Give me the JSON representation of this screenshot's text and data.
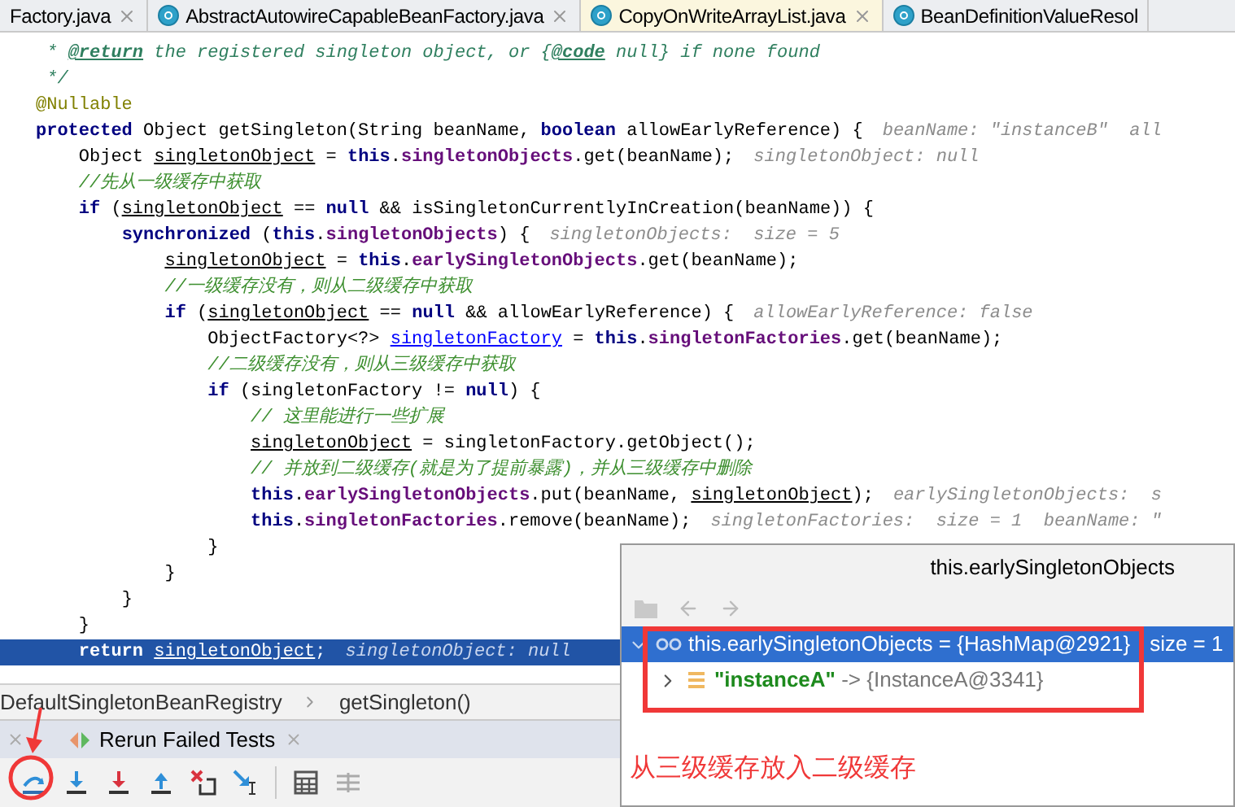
{
  "tabs": [
    {
      "label": "Factory.java",
      "selected": false,
      "icon": false
    },
    {
      "label": "AbstractAutowireCapableBeanFactory.java",
      "selected": false,
      "icon": true
    },
    {
      "label": "CopyOnWriteArrayList.java",
      "selected": true,
      "icon": true
    },
    {
      "label": "BeanDefinitionValueResol",
      "selected": false,
      "icon": true
    }
  ],
  "code_lines": [
    {
      "current": false,
      "tokens": [
        {
          "kind": "doc",
          "text": " * "
        },
        {
          "kind": "doctag",
          "text": "@return"
        },
        {
          "kind": "doc",
          "text": " the registered singleton object, or {"
        },
        {
          "kind": "doctag",
          "text": "@code"
        },
        {
          "kind": "doc",
          "text": " null} if none found"
        }
      ]
    },
    {
      "current": false,
      "tokens": [
        {
          "kind": "doc",
          "text": " */"
        }
      ]
    },
    {
      "current": false,
      "tokens": [
        {
          "kind": "annotation",
          "text": "@Nullable"
        }
      ]
    },
    {
      "current": false,
      "tokens": [
        {
          "kind": "keyword",
          "text": "protected"
        },
        {
          "kind": "plain",
          "text": " Object getSingleton(String beanName, "
        },
        {
          "kind": "keyword",
          "text": "boolean"
        },
        {
          "kind": "plain",
          "text": " allowEarlyReference) {"
        }
      ],
      "hint": "beanName: \"instanceB\"  all"
    },
    {
      "current": false,
      "tokens": [
        {
          "kind": "plain",
          "text": "    Object "
        },
        {
          "kind": "var",
          "text": "singletonObject"
        },
        {
          "kind": "plain",
          "text": " = "
        },
        {
          "kind": "keyword",
          "text": "this"
        },
        {
          "kind": "plain",
          "text": "."
        },
        {
          "kind": "field",
          "text": "singletonObjects"
        },
        {
          "kind": "plain",
          "text": ".get(beanName);"
        }
      ],
      "hint": "singletonObject: null"
    },
    {
      "current": false,
      "tokens": [
        {
          "kind": "comment",
          "text": "    //先从一级缓存中获取"
        }
      ]
    },
    {
      "current": false,
      "tokens": [
        {
          "kind": "keyword",
          "text": "    if"
        },
        {
          "kind": "plain",
          "text": " ("
        },
        {
          "kind": "var",
          "text": "singletonObject"
        },
        {
          "kind": "plain",
          "text": " == "
        },
        {
          "kind": "keyword",
          "text": "null"
        },
        {
          "kind": "plain",
          "text": " && isSingletonCurrentlyInCreation(beanName)) {"
        }
      ]
    },
    {
      "current": false,
      "tokens": [
        {
          "kind": "keyword",
          "text": "        synchronized"
        },
        {
          "kind": "plain",
          "text": " ("
        },
        {
          "kind": "keyword",
          "text": "this"
        },
        {
          "kind": "plain",
          "text": "."
        },
        {
          "kind": "field",
          "text": "singletonObjects"
        },
        {
          "kind": "plain",
          "text": ") {"
        }
      ],
      "hint": "singletonObjects:  size = 5"
    },
    {
      "current": false,
      "tokens": [
        {
          "kind": "var",
          "text": "            singletonObject"
        },
        {
          "kind": "plain",
          "text": " = "
        },
        {
          "kind": "keyword",
          "text": "this"
        },
        {
          "kind": "plain",
          "text": "."
        },
        {
          "kind": "field",
          "text": "earlySingletonObjects"
        },
        {
          "kind": "plain",
          "text": ".get(beanName);"
        }
      ]
    },
    {
      "current": false,
      "tokens": [
        {
          "kind": "comment",
          "text": "            //一级缓存没有，则从二级缓存中获取"
        }
      ]
    },
    {
      "current": false,
      "tokens": [
        {
          "kind": "keyword",
          "text": "            if"
        },
        {
          "kind": "plain",
          "text": " ("
        },
        {
          "kind": "var",
          "text": "singletonObject"
        },
        {
          "kind": "plain",
          "text": " == "
        },
        {
          "kind": "keyword",
          "text": "null"
        },
        {
          "kind": "plain",
          "text": " && allowEarlyReference) {"
        }
      ],
      "hint": "allowEarlyReference: false"
    },
    {
      "current": false,
      "tokens": [
        {
          "kind": "plain",
          "text": "                ObjectFactory<?> "
        },
        {
          "kind": "usage",
          "text": "singletonFactory"
        },
        {
          "kind": "plain",
          "text": " = "
        },
        {
          "kind": "keyword",
          "text": "this"
        },
        {
          "kind": "plain",
          "text": "."
        },
        {
          "kind": "field",
          "text": "singletonFactories"
        },
        {
          "kind": "plain",
          "text": ".get(beanName);"
        }
      ]
    },
    {
      "current": false,
      "tokens": [
        {
          "kind": "comment",
          "text": "                //二级缓存没有，则从三级缓存中获取"
        }
      ]
    },
    {
      "current": false,
      "tokens": [
        {
          "kind": "keyword",
          "text": "                if"
        },
        {
          "kind": "plain",
          "text": " (singletonFactory != "
        },
        {
          "kind": "keyword",
          "text": "null"
        },
        {
          "kind": "plain",
          "text": ") {"
        }
      ]
    },
    {
      "current": false,
      "tokens": [
        {
          "kind": "comment",
          "text": "                    // 这里能进行一些扩展"
        }
      ]
    },
    {
      "current": false,
      "tokens": [
        {
          "kind": "var",
          "text": "                    singletonObject"
        },
        {
          "kind": "plain",
          "text": " = singletonFactory.getObject();"
        }
      ]
    },
    {
      "current": false,
      "tokens": [
        {
          "kind": "comment",
          "text": "                    // 并放到二级缓存(就是为了提前暴露)，并从三级缓存中删除"
        }
      ]
    },
    {
      "current": false,
      "tokens": [
        {
          "kind": "keyword",
          "text": "                    this"
        },
        {
          "kind": "plain",
          "text": "."
        },
        {
          "kind": "field",
          "text": "earlySingletonObjects"
        },
        {
          "kind": "plain",
          "text": ".put(beanName, "
        },
        {
          "kind": "var",
          "text": "singletonObject"
        },
        {
          "kind": "plain",
          "text": ");"
        }
      ],
      "hint": "earlySingletonObjects:  s"
    },
    {
      "current": false,
      "tokens": [
        {
          "kind": "keyword",
          "text": "                    this"
        },
        {
          "kind": "plain",
          "text": "."
        },
        {
          "kind": "field",
          "text": "singletonFactories"
        },
        {
          "kind": "plain",
          "text": ".remove(beanName);"
        }
      ],
      "hint": "singletonFactories:  size = 1  beanName: \""
    },
    {
      "current": false,
      "tokens": [
        {
          "kind": "plain",
          "text": "                }"
        }
      ]
    },
    {
      "current": false,
      "tokens": [
        {
          "kind": "plain",
          "text": "            }"
        }
      ]
    },
    {
      "current": false,
      "tokens": [
        {
          "kind": "plain",
          "text": "        }"
        }
      ]
    },
    {
      "current": false,
      "tokens": [
        {
          "kind": "plain",
          "text": "    }"
        }
      ]
    },
    {
      "current": true,
      "tokens": [
        {
          "kind": "keyword",
          "text": "    return "
        },
        {
          "kind": "var",
          "text": "singletonObject"
        },
        {
          "kind": "plain",
          "text": ";"
        }
      ],
      "hint": "singletonObject: null"
    }
  ],
  "breadcrumb": [
    "DefaultSingletonBeanRegistry",
    "getSingleton()"
  ],
  "tool_tab": {
    "label": "Rerun Failed Tests"
  },
  "popup": {
    "title": "this.earlySingletonObjects",
    "tree": [
      {
        "text": "this.earlySingletonObjects = {HashMap@2921}",
        "detail": "size = 1",
        "selected": true,
        "expanded": true,
        "children": [
          {
            "key": "\"instanceA\"",
            "arrow": "->",
            "value": "{InstanceA@3341}",
            "selected": false,
            "expanded": false
          }
        ]
      }
    ]
  },
  "annotation": {
    "note": "从三级缓存放入二级缓存"
  }
}
